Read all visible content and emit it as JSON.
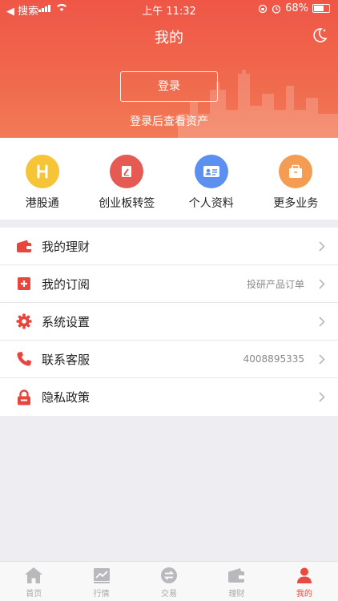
{
  "status_bar": {
    "back_label": "◀ 搜索",
    "time": "上午 11:32",
    "battery": "68%",
    "battery_level": 0.68
  },
  "header": {
    "title": "我的",
    "login_label": "登录",
    "login_hint": "登录后查看资产"
  },
  "quick_actions": [
    {
      "label": "港股通",
      "icon": "h-icon",
      "color": "#f5c537"
    },
    {
      "label": "创业板转签",
      "icon": "document-pen-icon",
      "color": "#e55a52"
    },
    {
      "label": "个人资料",
      "icon": "id-card-icon",
      "color": "#5b8ff0"
    },
    {
      "label": "更多业务",
      "icon": "box-icon",
      "color": "#f39c52"
    }
  ],
  "menu": [
    {
      "label": "我的理财",
      "value": "",
      "icon": "wallet-icon"
    },
    {
      "label": "我的订阅",
      "value": "投研产品订单",
      "icon": "plus-box-icon"
    },
    {
      "label": "系统设置",
      "value": "",
      "icon": "gear-icon"
    },
    {
      "label": "联系客服",
      "value": "4008895335",
      "icon": "phone-icon"
    },
    {
      "label": "隐私政策",
      "value": "",
      "icon": "lock-icon"
    }
  ],
  "tabs": [
    {
      "label": "首页",
      "icon": "home-icon"
    },
    {
      "label": "行情",
      "icon": "chart-icon"
    },
    {
      "label": "交易",
      "icon": "exchange-icon"
    },
    {
      "label": "理财",
      "icon": "wallet-icon"
    },
    {
      "label": "我的",
      "icon": "user-icon",
      "active": true
    }
  ],
  "accent_color": "#ea4a3f"
}
